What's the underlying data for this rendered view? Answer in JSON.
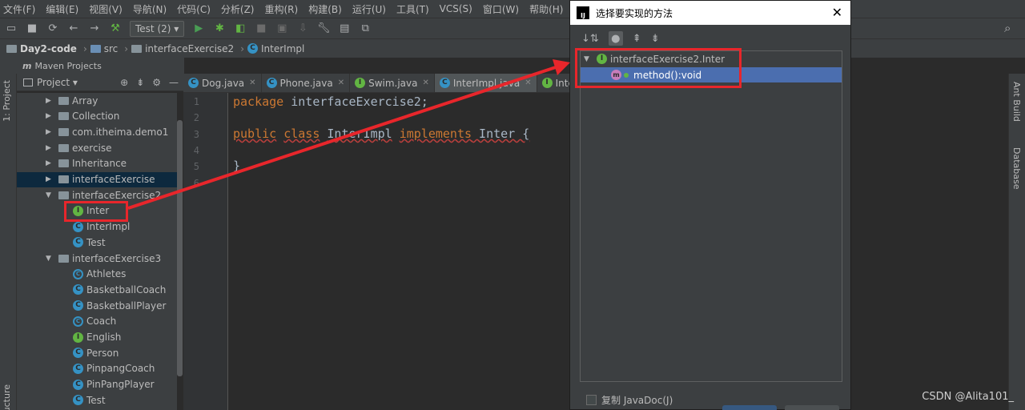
{
  "menubar": [
    "文件(F)",
    "编辑(E)",
    "视图(V)",
    "导航(N)",
    "代码(C)",
    "分析(Z)",
    "重构(R)",
    "构建(B)",
    "运行(U)",
    "工具(T)",
    "VCS(S)",
    "窗口(W)",
    "帮助(H)"
  ],
  "toolbar": {
    "run_config": "Test (2)"
  },
  "breadcrumb": {
    "project": "Day2-code",
    "src": "src",
    "package": "interfaceExercise2",
    "class": "InterImpl"
  },
  "maven_label": "Maven Projects",
  "left_stripe": {
    "project": "1: Project",
    "structure": "ucture"
  },
  "right_stripe": {
    "ant": "Ant Build",
    "database": "Database"
  },
  "project_panel": {
    "title": "Project",
    "tree": [
      {
        "label": "Array",
        "kind": "folder",
        "depth": 0,
        "expanded": false
      },
      {
        "label": "Collection",
        "kind": "folder",
        "depth": 0,
        "expanded": false
      },
      {
        "label": "com.itheima.demo1",
        "kind": "folder",
        "depth": 0,
        "expanded": false
      },
      {
        "label": "exercise",
        "kind": "folder",
        "depth": 0,
        "expanded": false
      },
      {
        "label": "Inheritance",
        "kind": "folder",
        "depth": 0,
        "expanded": false
      },
      {
        "label": "interfaceExercise",
        "kind": "folder",
        "depth": 0,
        "expanded": false,
        "selected": true
      },
      {
        "label": "interfaceExercise2",
        "kind": "folder",
        "depth": 0,
        "expanded": true
      },
      {
        "label": "Inter",
        "kind": "interface",
        "depth": 1
      },
      {
        "label": "InterImpl",
        "kind": "class",
        "depth": 1
      },
      {
        "label": "Test",
        "kind": "class",
        "depth": 1
      },
      {
        "label": "interfaceExercise3",
        "kind": "folder",
        "depth": 0,
        "expanded": true
      },
      {
        "label": "Athletes",
        "kind": "abstract",
        "depth": 1
      },
      {
        "label": "BasketballCoach",
        "kind": "class",
        "depth": 1
      },
      {
        "label": "BasketballPlayer",
        "kind": "class",
        "depth": 1
      },
      {
        "label": "Coach",
        "kind": "abstract",
        "depth": 1
      },
      {
        "label": "English",
        "kind": "interface",
        "depth": 1
      },
      {
        "label": "Person",
        "kind": "class",
        "depth": 1
      },
      {
        "label": "PinpangCoach",
        "kind": "class",
        "depth": 1
      },
      {
        "label": "PinPangPlayer",
        "kind": "class",
        "depth": 1
      },
      {
        "label": "Test",
        "kind": "class",
        "depth": 1
      }
    ]
  },
  "tabs": [
    {
      "label": "Dog.java",
      "kind": "class"
    },
    {
      "label": "Phone.java",
      "kind": "class"
    },
    {
      "label": "Swim.java",
      "kind": "interface"
    },
    {
      "label": "InterImpl.java",
      "kind": "class",
      "active": true
    },
    {
      "label": "Inter.ja",
      "kind": "interface"
    }
  ],
  "editor": {
    "line_numbers": [
      "1",
      "2",
      "3",
      "4",
      "5",
      "6"
    ],
    "line1_kw": "package",
    "line1_rest": " interfaceExercise2;",
    "line3_kw1": "public",
    "line3_kw2": "class",
    "line3_name": "InterImpl",
    "line3_kw3": "implements",
    "line3_rest": " Inter {",
    "line5": "}"
  },
  "dialog": {
    "title": "选择要实现的方法",
    "tree_root": "interfaceExercise2.Inter",
    "method": "method():void",
    "checkbox_label": "复制 JavaDoc(J)"
  },
  "watermark": "CSDN @Alita101_",
  "colors": {
    "accent_red": "#e8262b",
    "selection_blue": "#4b6eaf"
  }
}
